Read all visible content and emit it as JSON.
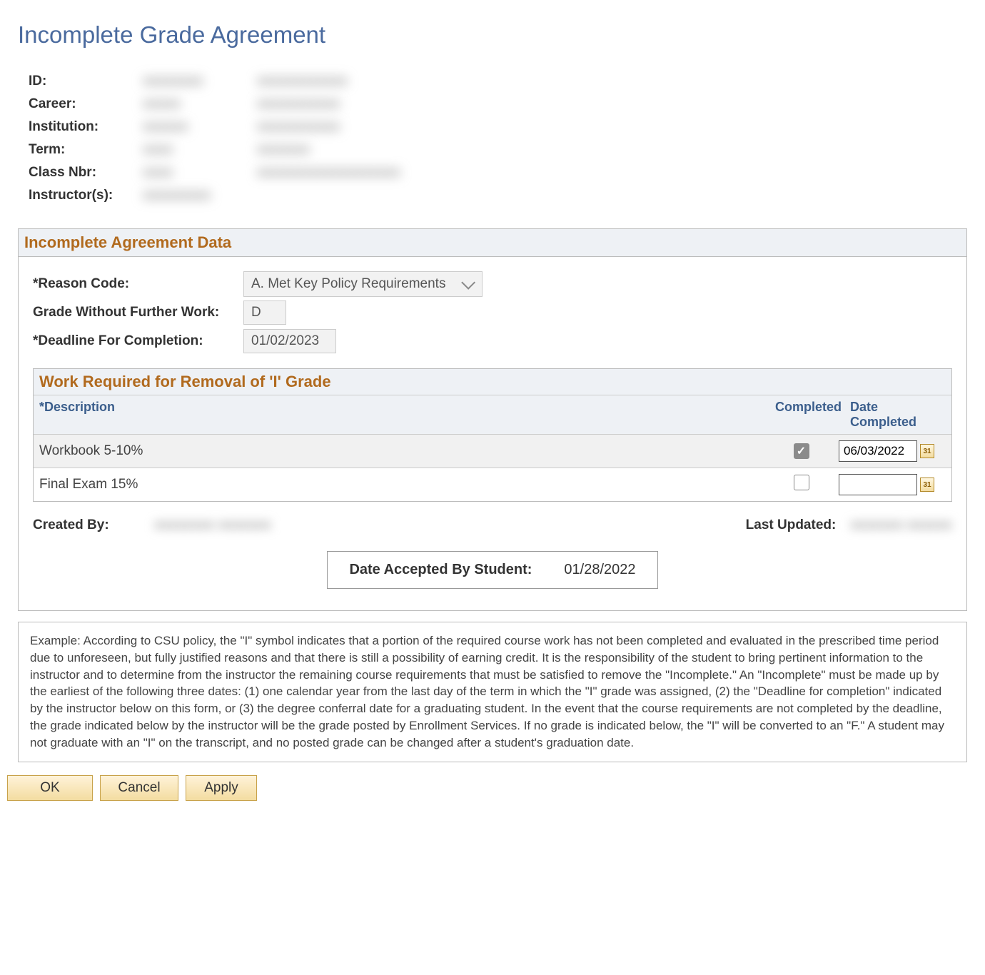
{
  "page_title": "Incomplete Grade Agreement",
  "info": {
    "labels": {
      "id": "ID:",
      "career": "Career:",
      "institution": "Institution:",
      "term": "Term:",
      "class_nbr": "Class Nbr:",
      "instructors": "Instructor(s):"
    },
    "values1": [
      "xxxxxxxx",
      "xxxxx",
      "xxxxxx",
      "xxxx",
      "xxxx",
      "xxxxxxxxx"
    ],
    "values2": [
      "xxxxxxxxxxxx",
      "xxxxxxxxxxx",
      "xxxxxxxxxxx",
      "xxxxxxx",
      "xxxxxxxxxxxxxxxxxxx",
      ""
    ]
  },
  "agreement": {
    "title": "Incomplete Agreement Data",
    "reason_label": "*Reason Code:",
    "reason_value": "A. Met Key Policy Requirements",
    "grade_label": "Grade Without Further Work:",
    "grade_value": "D",
    "deadline_label": "*Deadline For Completion:",
    "deadline_value": "01/02/2023"
  },
  "work": {
    "title": "Work Required for Removal of 'I' Grade",
    "cols": {
      "desc": "*Description",
      "completed": "Completed",
      "date": "Date Completed"
    },
    "rows": [
      {
        "desc": "Workbook 5-10%",
        "completed": true,
        "date": "06/03/2022"
      },
      {
        "desc": "Final Exam 15%",
        "completed": false,
        "date": ""
      }
    ]
  },
  "meta": {
    "created_by_label": "Created By:",
    "created_by_val": "xxxxxxxx  xxxxxxx",
    "last_updated_label": "Last Updated:",
    "last_updated_val": "xxxxxxx  xxxxxx",
    "accepted_label": "Date Accepted By Student:",
    "accepted_value": "01/28/2022"
  },
  "policy_text": "Example: According to CSU policy, the \"I\" symbol indicates that a portion of the required course work has not been completed and evaluated in the prescribed time period due to unforeseen, but fully justified reasons and that there is still a possibility of earning credit. It is the responsibility of the student to bring pertinent information to the instructor and to determine from the instructor the remaining course requirements that must be satisfied to remove the \"Incomplete.\"  An \"Incomplete\" must be made up by the earliest of the following three dates: (1) one calendar year from the last day of the term in which the \"I\" grade was assigned, (2) the \"Deadline for completion\" indicated by the instructor below on this form, or (3) the degree conferral date for a graduating student.  In the event that the course requirements are not completed by the deadline, the grade indicated below by the instructor will be the grade posted by Enrollment Services.  If no grade is indicated below, the \"I\" will be converted to an \"F.\"  A student may not graduate with an \"I\" on the transcript, and no posted grade can be changed after a student's graduation date.",
  "buttons": {
    "ok": "OK",
    "cancel": "Cancel",
    "apply": "Apply"
  }
}
